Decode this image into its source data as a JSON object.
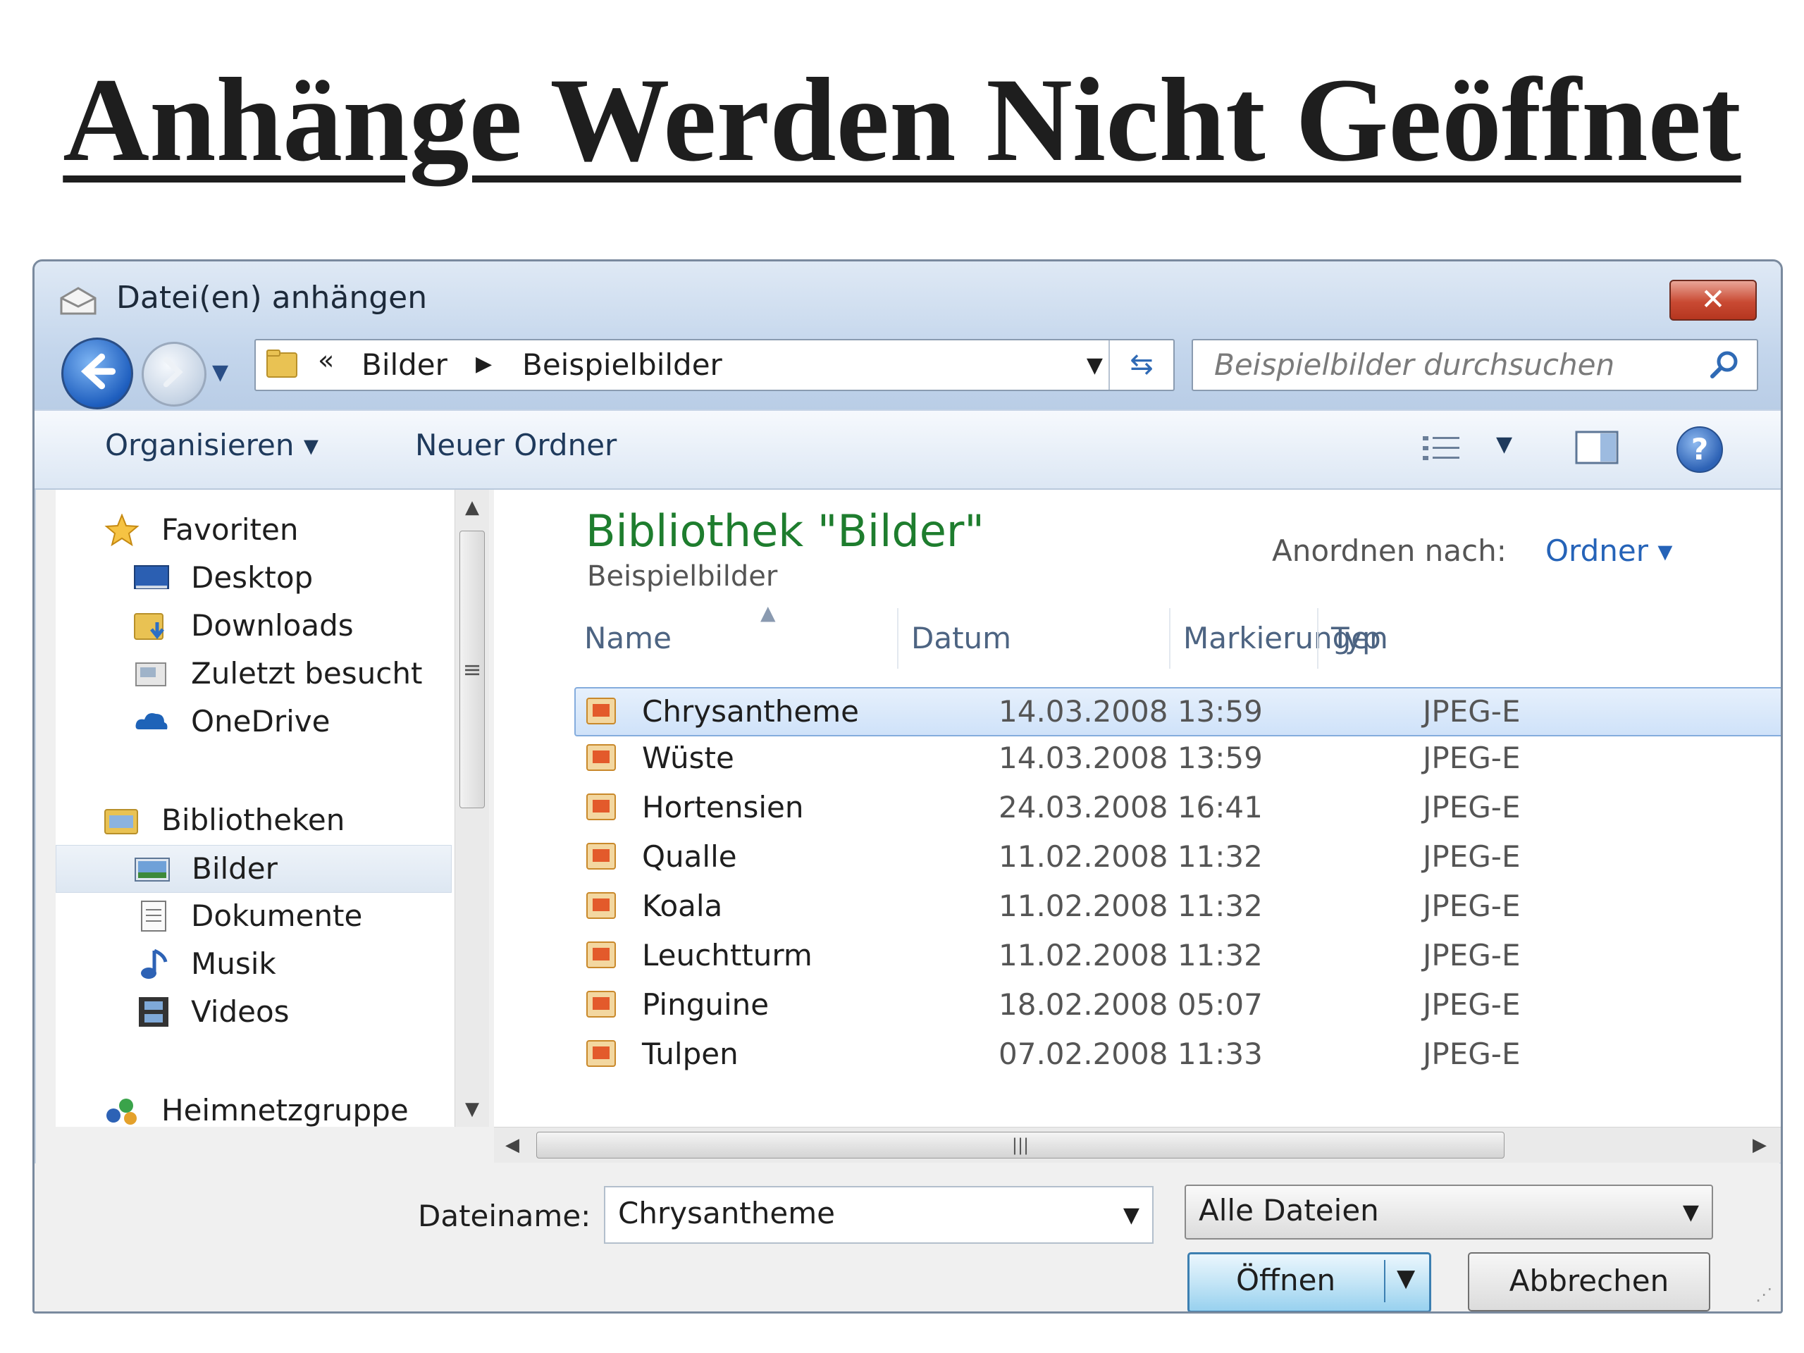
{
  "page_title": "Anhänge Werden Nicht Geöffnet",
  "dialog": {
    "title": "Datei(en) anhängen",
    "close_label": "✕",
    "address": {
      "overflow": "«",
      "crumbs": [
        "Bilder",
        "Beispielbilder"
      ]
    },
    "search_placeholder": "Beispielbilder durchsuchen",
    "toolbar": {
      "organize": "Organisieren ▾",
      "new_folder": "Neuer Ordner",
      "help": "?"
    },
    "nav": {
      "items": [
        {
          "label": "Favoriten",
          "icon": "star-icon"
        },
        {
          "label": "Desktop",
          "icon": "desktop-icon"
        },
        {
          "label": "Downloads",
          "icon": "downloads-folder-icon"
        },
        {
          "label": "Zuletzt besucht",
          "icon": "recent-places-icon"
        },
        {
          "label": "OneDrive",
          "icon": "onedrive-cloud-icon"
        },
        {
          "label": "Bibliotheken",
          "icon": "libraries-icon"
        },
        {
          "label": "Bilder",
          "icon": "pictures-library-icon",
          "selected": true
        },
        {
          "label": "Dokumente",
          "icon": "documents-icon"
        },
        {
          "label": "Musik",
          "icon": "music-note-icon"
        },
        {
          "label": "Videos",
          "icon": "film-icon"
        },
        {
          "label": "Heimnetzgruppe",
          "icon": "homegroup-icon"
        }
      ]
    },
    "library": {
      "title": "Bibliothek \"Bilder\"",
      "subtitle": "Beispielbilder",
      "arrange_label": "Anordnen nach:",
      "arrange_value": "Ordner ▾"
    },
    "columns": [
      "Name",
      "Datum",
      "Markierungen",
      "Typ"
    ],
    "files": [
      {
        "name": "Chrysantheme",
        "date": "14.03.2008 13:59",
        "type": "JPEG-E",
        "selected": true
      },
      {
        "name": "Wüste",
        "date": "14.03.2008 13:59",
        "type": "JPEG-E"
      },
      {
        "name": "Hortensien",
        "date": "24.03.2008 16:41",
        "type": "JPEG-E"
      },
      {
        "name": "Qualle",
        "date": "11.02.2008 11:32",
        "type": "JPEG-E"
      },
      {
        "name": "Koala",
        "date": "11.02.2008 11:32",
        "type": "JPEG-E"
      },
      {
        "name": "Leuchtturm",
        "date": "11.02.2008 11:32",
        "type": "JPEG-E"
      },
      {
        "name": "Pinguine",
        "date": "18.02.2008 05:07",
        "type": "JPEG-E"
      },
      {
        "name": "Tulpen",
        "date": "07.02.2008 11:33",
        "type": "JPEG-E"
      }
    ],
    "footer": {
      "filename_label": "Dateiname:",
      "filename_value": "Chrysantheme",
      "filetype_value": "Alle Dateien",
      "open_label": "Öffnen",
      "cancel_label": "Abbrechen"
    }
  }
}
